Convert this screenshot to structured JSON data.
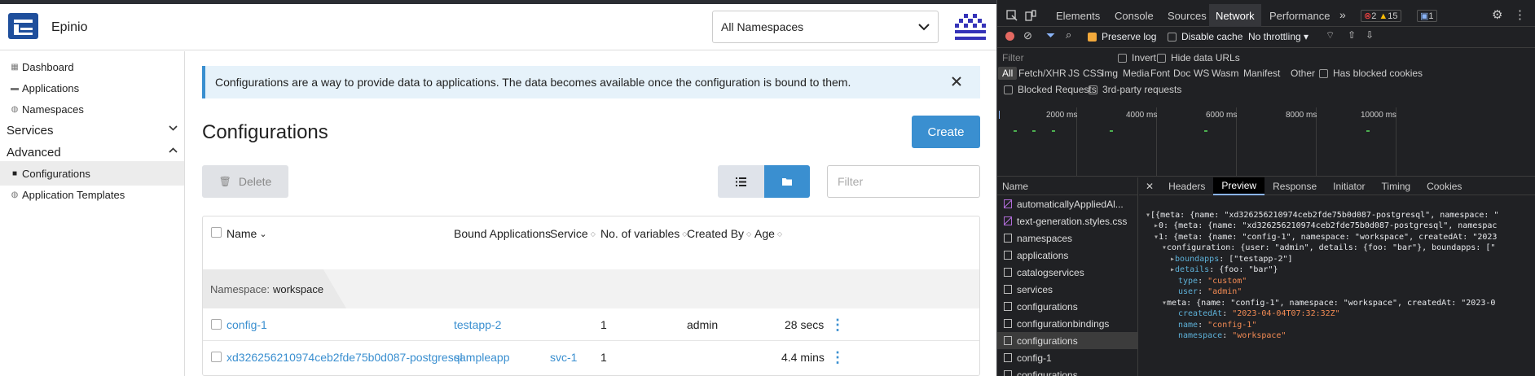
{
  "app": {
    "brand": "Epinio",
    "namespace_select": "All Namespaces",
    "sidebar": {
      "items_top": [
        {
          "label": "Dashboard"
        },
        {
          "label": "Applications"
        },
        {
          "label": "Namespaces"
        }
      ],
      "groups": [
        {
          "label": "Services"
        },
        {
          "label": "Advanced"
        }
      ],
      "items_advanced": [
        {
          "label": "Configurations"
        },
        {
          "label": "Application Templates"
        }
      ]
    },
    "banner": "Configurations are a way to provide data to applications. The data becomes available once the configuration is bound to them.",
    "page_title": "Configurations",
    "create_label": "Create",
    "delete_label": "Delete",
    "filter_placeholder": "Filter",
    "columns": [
      "Name",
      "Bound Applications",
      "Service",
      "No. of variables",
      "Created By",
      "Age"
    ],
    "group_prefix": "Namespace:",
    "group_value": "workspace",
    "rows": [
      {
        "name": "config-1",
        "bound": "testapp-2",
        "service": "",
        "vars": "1",
        "created_by": "admin",
        "age": "28 secs"
      },
      {
        "name": "xd326256210974ceb2fde75b0d087-postgresql",
        "bound": "sampleapp",
        "service": "svc-1",
        "vars": "1",
        "created_by": "",
        "age": "4.4 mins"
      }
    ]
  },
  "devtools": {
    "tabs": [
      "Elements",
      "Console",
      "Sources",
      "Network",
      "Performance"
    ],
    "badges": {
      "errors": "2",
      "warnings": "15",
      "messages": "1"
    },
    "toolbar": {
      "preserve_log": "Preserve log",
      "disable_cache": "Disable cache",
      "throttling": "No throttling"
    },
    "filter_placeholder": "Filter",
    "invert": "Invert",
    "hide_data_urls": "Hide data URLs",
    "types": [
      "All",
      "Fetch/XHR",
      "JS",
      "CSS",
      "Img",
      "Media",
      "Font",
      "Doc",
      "WS",
      "Wasm",
      "Manifest",
      "Other"
    ],
    "has_blocked_cookies": "Has blocked cookies",
    "blocked_requests": "Blocked Requests",
    "third_party": "3rd-party requests",
    "timeline_labels": [
      "2000 ms",
      "4000 ms",
      "6000 ms",
      "8000 ms",
      "10000 ms"
    ],
    "name_header": "Name",
    "requests": [
      "automaticallyAppliedAl...",
      "text-generation.styles.css",
      "namespaces",
      "applications",
      "catalogservices",
      "services",
      "configurations",
      "configurationbindings",
      "configurations",
      "config-1",
      "configurations"
    ],
    "detail_tabs": [
      "Headers",
      "Preview",
      "Response",
      "Initiator",
      "Timing",
      "Cookies"
    ],
    "preview": {
      "l0": "[{meta: {name: \"xd326256210974ceb2fde75b0d087-postgresql\", namespace: \"",
      "l1": "0: {meta: {name: \"xd326256210974ceb2fde75b0d087-postgresql\", namespac",
      "l2": "1: {meta: {name: \"config-1\", namespace: \"workspace\", createdAt: \"2023",
      "l3": "configuration: {user: \"admin\", details: {foo: \"bar\"}, boundapps: [\"",
      "l4k": "boundapps",
      "l4v": "[\"testapp-2\"]",
      "l5k": "details",
      "l5v": "{foo: \"bar\"}",
      "l6k": "type",
      "l6v": "\"custom\"",
      "l7k": "user",
      "l7v": "\"admin\"",
      "l8": "meta: {name: \"config-1\", namespace: \"workspace\", createdAt: \"2023-0",
      "l9k": "createdAt",
      "l9v": "\"2023-04-04T07:32:32Z\"",
      "l10k": "name",
      "l10v": "\"config-1\"",
      "l11k": "namespace",
      "l11v": "\"workspace\""
    }
  }
}
